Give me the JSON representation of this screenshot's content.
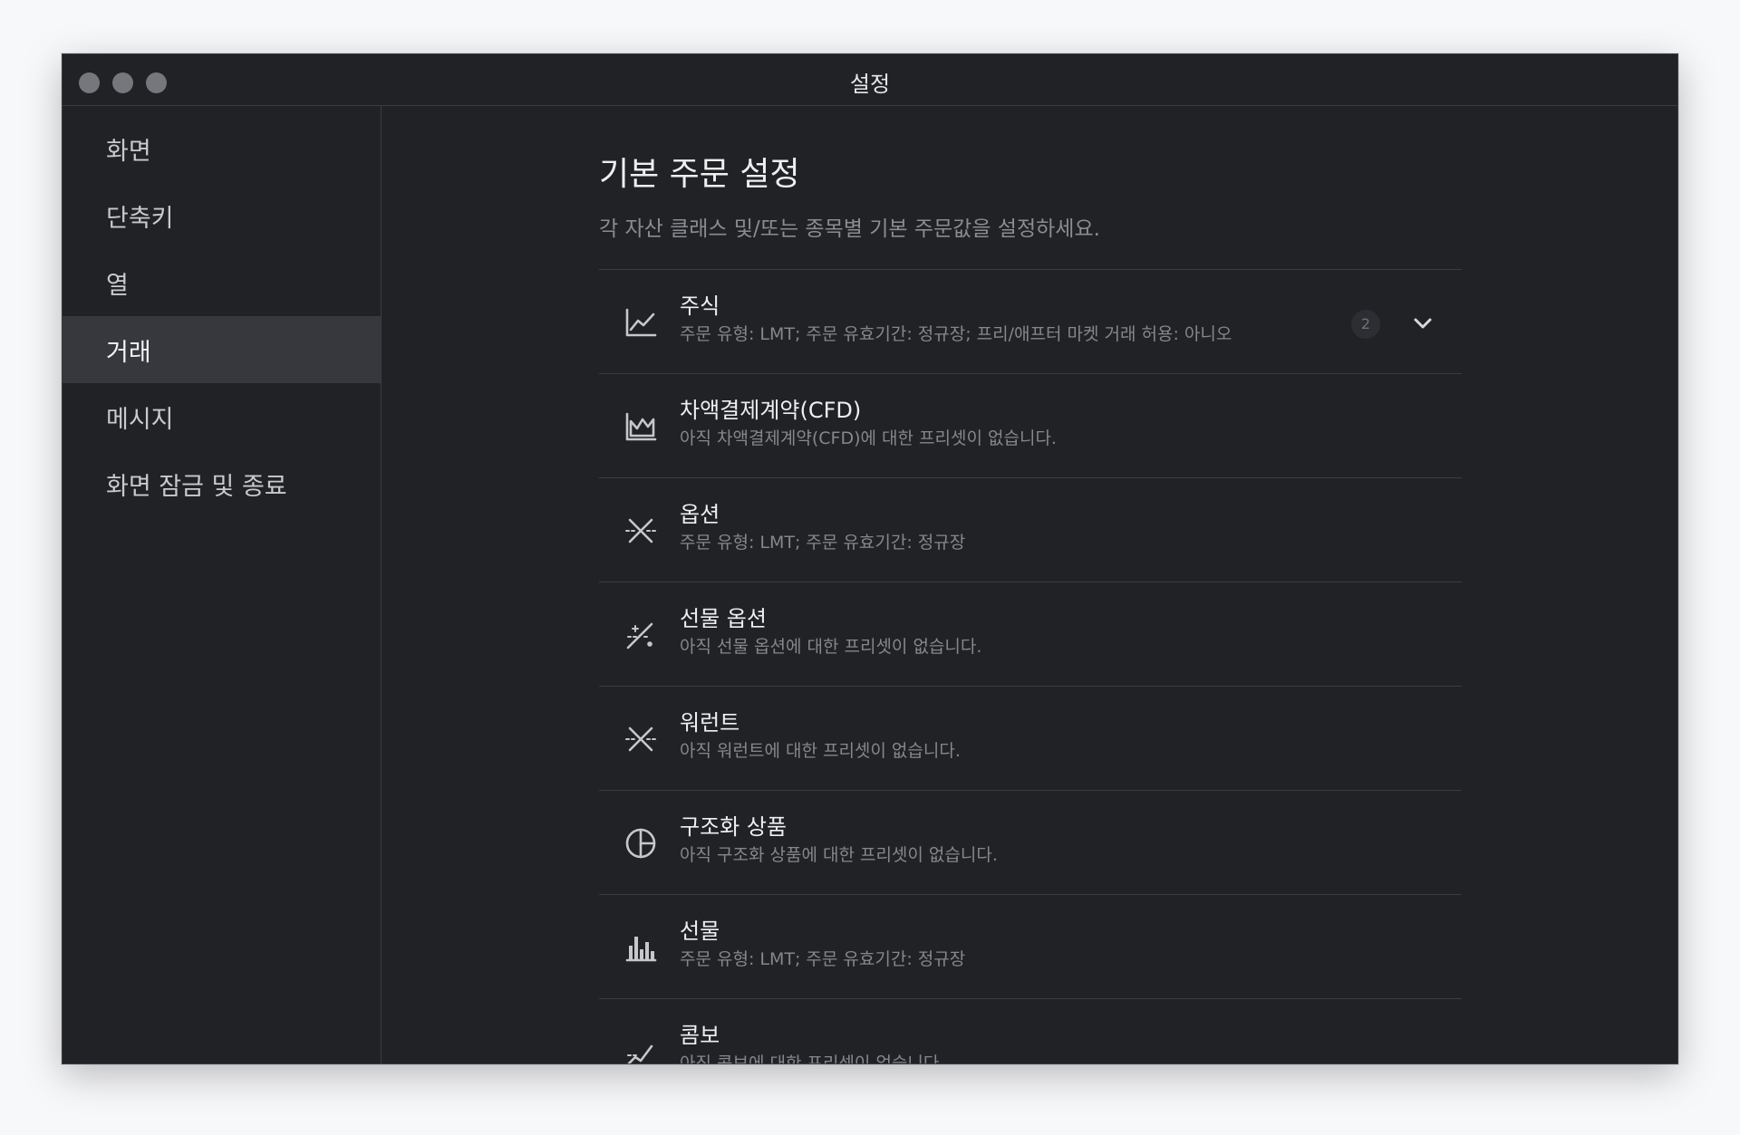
{
  "window": {
    "title": "설정"
  },
  "sidebar": {
    "items": [
      {
        "label": "화면",
        "active": false
      },
      {
        "label": "단축키",
        "active": false
      },
      {
        "label": "열",
        "active": false
      },
      {
        "label": "거래",
        "active": true
      },
      {
        "label": "메시지",
        "active": false
      },
      {
        "label": "화면 잠금 및 종료",
        "active": false
      }
    ]
  },
  "main": {
    "title": "기본 주문 설정",
    "description": "각 자산 클래스 및/또는 종목별 기본 주문값을 설정하세요.",
    "assets": [
      {
        "name": "주식",
        "desc": "주문 유형: LMT; 주문 유효기간: 정규장; 프리/애프터 마켓 거래 허용: 아니오",
        "icon": "line-chart-icon",
        "badge": "2"
      },
      {
        "name": "차액결제계약(CFD)",
        "desc": "아직 차액결제계약(CFD)에 대한 프리셋이 없습니다.",
        "icon": "area-chart-icon"
      },
      {
        "name": "옵션",
        "desc": "주문 유형: LMT; 주문 유효기간: 정규장",
        "icon": "options-cross-icon"
      },
      {
        "name": "선물 옵션",
        "desc": "아직 선물 옵션에 대한 프리셋이 없습니다.",
        "icon": "futures-options-icon"
      },
      {
        "name": "워런트",
        "desc": "아직 워런트에 대한 프리셋이 없습니다.",
        "icon": "warrant-cross-icon"
      },
      {
        "name": "구조화 상품",
        "desc": "아직 구조화 상품에 대한 프리셋이 없습니다.",
        "icon": "pie-chart-icon"
      },
      {
        "name": "선물",
        "desc": "주문 유형: LMT; 주문 유효기간: 정규장",
        "icon": "bar-chart-icon"
      },
      {
        "name": "콤보",
        "desc": "아직 콤보에 대한 프리셋이 없습니다.",
        "icon": "combo-icon"
      }
    ]
  },
  "colors": {
    "window_bg": "#202226",
    "active_item_bg": "#36383d",
    "divider": "#3a3c41",
    "primary_text": "#eeeff1",
    "secondary_text": "#85878c"
  }
}
